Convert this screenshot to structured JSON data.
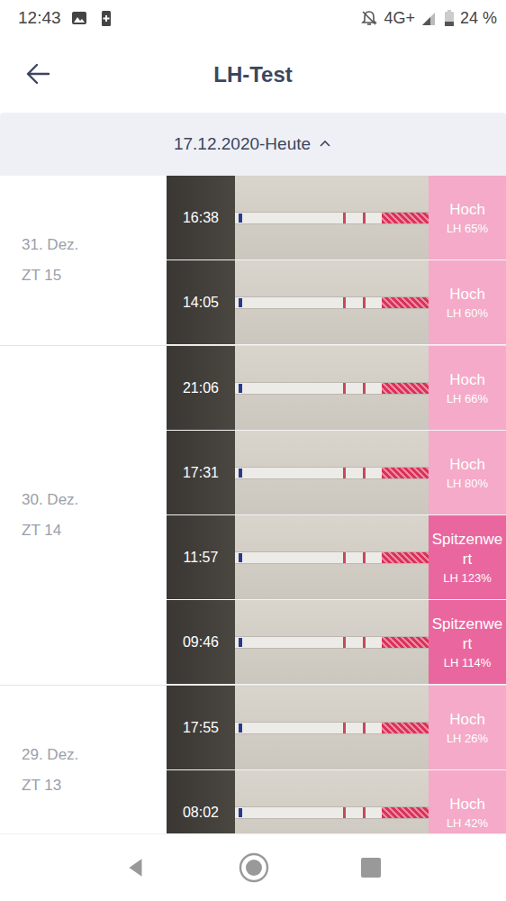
{
  "status_bar": {
    "time": "12:43",
    "network": "4G+",
    "battery": "24 %"
  },
  "header": {
    "title": "LH-Test"
  },
  "date_range": {
    "label": "17.12.2020-Heute",
    "expanded": true
  },
  "days": [
    {
      "date": "31. Dez.",
      "cycle_day": "ZT 15",
      "tests": [
        {
          "time": "16:38",
          "result": "Hoch",
          "lh": "LH 65%",
          "peak": false
        },
        {
          "time": "14:05",
          "result": "Hoch",
          "lh": "LH 60%",
          "peak": false
        }
      ]
    },
    {
      "date": "30. Dez.",
      "cycle_day": "ZT 14",
      "tests": [
        {
          "time": "21:06",
          "result": "Hoch",
          "lh": "LH 66%",
          "peak": false
        },
        {
          "time": "17:31",
          "result": "Hoch",
          "lh": "LH 80%",
          "peak": false
        },
        {
          "time": "11:57",
          "result": "Spitzenwert",
          "lh": "LH 123%",
          "peak": true
        },
        {
          "time": "09:46",
          "result": "Spitzenwert",
          "lh": "LH 114%",
          "peak": true
        }
      ]
    },
    {
      "date": "29. Dez.",
      "cycle_day": "ZT 13",
      "tests": [
        {
          "time": "17:55",
          "result": "Hoch",
          "lh": "LH 26%",
          "peak": false
        },
        {
          "time": "08:02",
          "result": "Hoch",
          "lh": "LH 42%",
          "peak": false
        }
      ]
    }
  ]
}
